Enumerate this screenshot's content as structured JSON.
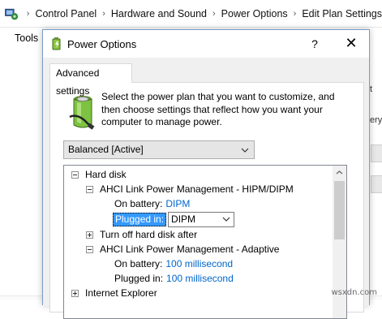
{
  "control_panel": {
    "breadcrumbs": [
      "Control Panel",
      "Hardware and Sound",
      "Power Options",
      "Edit Plan Settings"
    ],
    "menu_tools": "Tools",
    "right_fragments": [
      "t",
      "ery"
    ]
  },
  "dialog": {
    "title": "Power Options",
    "help_label": "?",
    "close_label": "✕",
    "tab_label": "Advanced settings",
    "intro_text": "Select the power plan that you want to customize, and then choose settings that reflect how you want your computer to manage power.",
    "plan_selected": "Balanced [Active]",
    "tree": {
      "hard_disk": "Hard disk",
      "hipm_dipm": "AHCI Link Power Management - HIPM/DIPM",
      "on_battery_label": "On battery:",
      "on_battery_value": "DIPM",
      "plugged_in_label": "Plugged in:",
      "plugged_in_value": "DIPM",
      "turn_off_disk": "Turn off hard disk after",
      "adaptive": "AHCI Link Power Management - Adaptive",
      "adaptive_battery_label": "On battery:",
      "adaptive_battery_value": "100 millisecond",
      "adaptive_plugged_label": "Plugged in:",
      "adaptive_plugged_value": "100 millisecond",
      "internet_explorer": "Internet Explorer"
    }
  },
  "watermark": "wsxdn.com",
  "colors": {
    "link": "#0066cc",
    "selection": "#3399ff",
    "dialog_border": "#7a9cc7"
  }
}
